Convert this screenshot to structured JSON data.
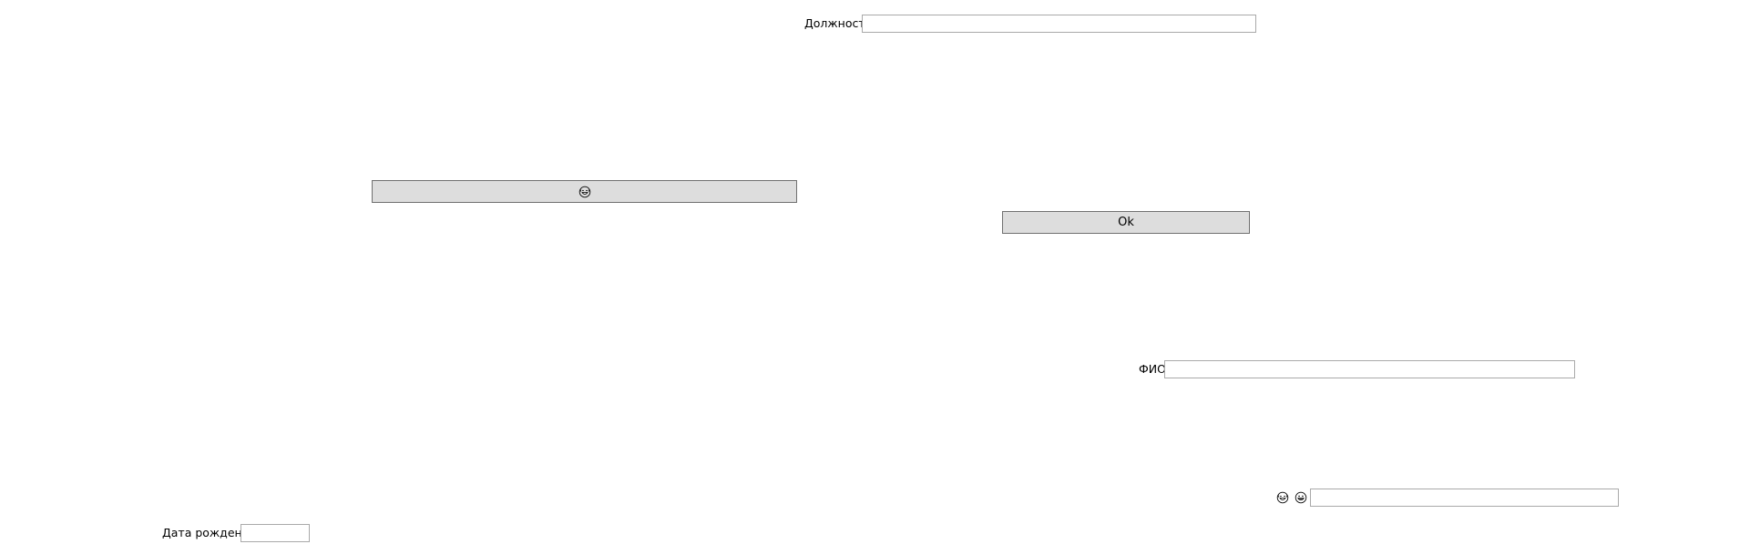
{
  "fields": {
    "position_label": "Должность",
    "position_value": "",
    "fullname_label": "ФИО",
    "fullname_value": "",
    "birthdate_label": "Дата рождения",
    "birthdate_value": "",
    "emoji_field_value": ""
  },
  "buttons": {
    "emoji_button_icon": "laughing-face-icon",
    "ok_label": "Ok"
  },
  "emoji_row": {
    "first_icon": "laughing-face-icon",
    "second_icon": "grinning-face-icon"
  },
  "colors": {
    "button_bg": "#dddddd",
    "button_border": "#707070",
    "input_border": "#a9a9a9"
  }
}
